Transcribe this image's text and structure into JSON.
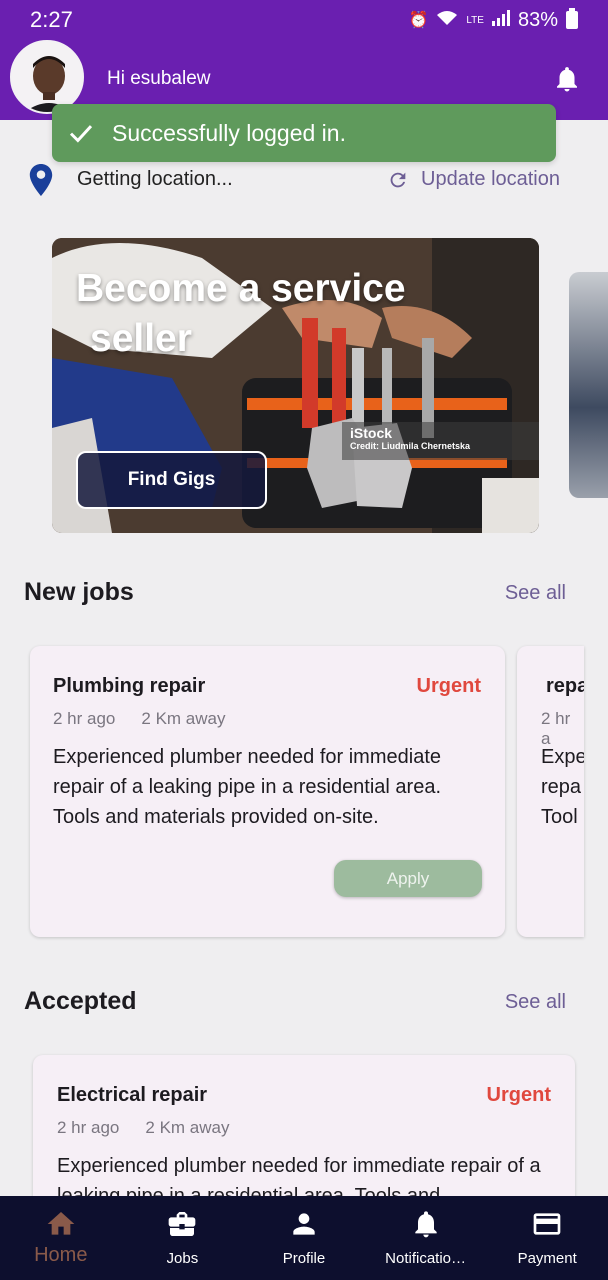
{
  "status_bar": {
    "time": "2:27",
    "battery": "83%",
    "network": "LTE"
  },
  "header": {
    "greeting": "Hi esubalew"
  },
  "snackbar": {
    "message": "Successfully logged in."
  },
  "location": {
    "text": "Getting location...",
    "update_label": "Update location"
  },
  "banner": {
    "title_line1": "Become a service",
    "title_line2": "seller",
    "button_label": "Find Gigs",
    "watermark_brand": "iStock",
    "watermark_credit": "Credit: Liudmila Chernetska"
  },
  "new_jobs": {
    "title": "New jobs",
    "see_all": "See all",
    "cards": [
      {
        "title": "Plumbing repair",
        "badge": "Urgent",
        "time": "2 hr ago",
        "distance": "2 Km away",
        "description": "Experienced plumber needed for immediate repair of a leaking pipe in a residential area. Tools and materials provided on-site.",
        "apply_label": "Apply"
      },
      {
        "title": "repa",
        "time": "2 hr a",
        "line1": "Expe",
        "line2": "repa",
        "line3": "Tool"
      }
    ]
  },
  "accepted": {
    "title": "Accepted",
    "see_all": "See all",
    "card": {
      "title": "Electrical repair",
      "badge": "Urgent",
      "time": "2 hr ago",
      "distance": "2 Km away",
      "description": "Experienced plumber needed for immediate repair of a leaking pipe in a residential area. Tools and"
    }
  },
  "bottom_nav": {
    "items": [
      {
        "label": "Home",
        "icon": "home-icon",
        "active": true
      },
      {
        "label": "Jobs",
        "icon": "briefcase-icon",
        "active": false
      },
      {
        "label": "Profile",
        "icon": "person-icon",
        "active": false
      },
      {
        "label": "Notificatio…",
        "icon": "bell-icon",
        "active": false
      },
      {
        "label": "Payment",
        "icon": "card-icon",
        "active": false
      }
    ]
  },
  "colors": {
    "primary": "#6a1fb0",
    "accent_text": "#6d5e95",
    "urgent": "#e0483e",
    "snackbar": "#5f9a5c",
    "nav_bg": "#0d0f2e"
  }
}
